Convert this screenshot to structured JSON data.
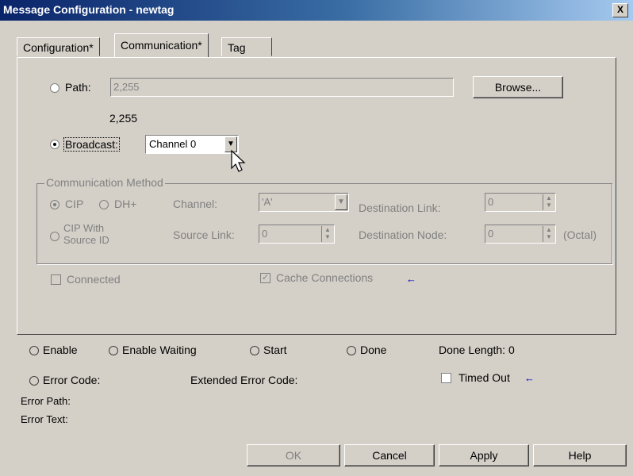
{
  "window": {
    "title": "Message Configuration - newtag",
    "close_label": "X"
  },
  "tabs": [
    {
      "label": "Configuration*"
    },
    {
      "label": "Communication*"
    },
    {
      "label": "Tag"
    }
  ],
  "path": {
    "label": "Path:",
    "value": "2,255",
    "resolved": "2,255",
    "browse_label": "Browse..."
  },
  "broadcast": {
    "label": "Broadcast:",
    "selected": "Channel 0"
  },
  "method": {
    "title": "Communication Method",
    "cip_label": "CIP",
    "dhplus_label": "DH+",
    "channel_label": "Channel:",
    "channel_value": "'A'",
    "dest_link_label": "Destination Link:",
    "dest_link_value": "0",
    "cip_with_source_label_1": "CIP With",
    "cip_with_source_label_2": "Source ID",
    "source_link_label": "Source Link:",
    "source_link_value": "0",
    "dest_node_label": "Destination Node:",
    "dest_node_value": "0",
    "octal_label": "(Octal)"
  },
  "options": {
    "connected_label": "Connected",
    "cache_label": "Cache Connections"
  },
  "status": {
    "enable": "Enable",
    "enable_waiting": "Enable Waiting",
    "start": "Start",
    "done": "Done",
    "done_length": "Done Length: 0",
    "error_code": "Error Code:",
    "extended_error_code": "Extended Error Code:",
    "timed_out": "Timed Out",
    "error_path": "Error Path:",
    "error_text": "Error Text:"
  },
  "buttons": {
    "ok": "OK",
    "cancel": "Cancel",
    "apply": "Apply",
    "help": "Help"
  }
}
